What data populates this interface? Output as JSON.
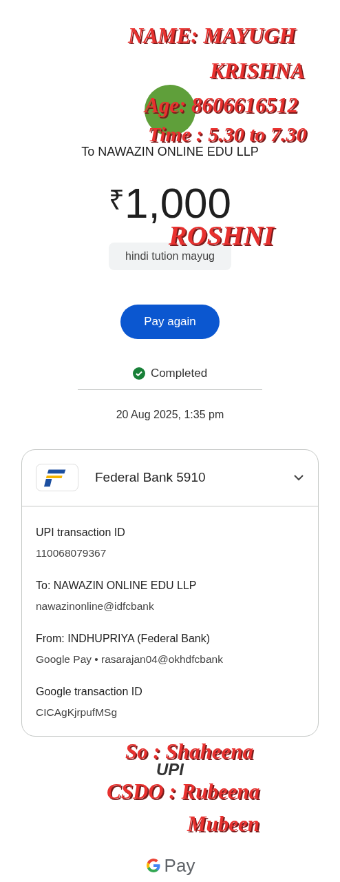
{
  "payee": {
    "line": "To NAWAZIN ONLINE EDU LLP"
  },
  "amount": {
    "currency": "₹",
    "value": "1,000"
  },
  "note": "hindi tution mayug",
  "pay_again_button": "Pay again",
  "status": {
    "label": "Completed"
  },
  "date": "20 Aug 2025, 1:35 pm",
  "account_card": {
    "bank": "Federal Bank 5910",
    "expanded": true,
    "details": [
      {
        "label": "UPI transaction ID",
        "value": "110068079367"
      },
      {
        "label": "To: NAWAZIN ONLINE EDU LLP",
        "value": "nawazinonline@idfcbank"
      },
      {
        "label": "From: INDHUPRIYA (Federal Bank)",
        "value": "Google Pay • rasarajan04@okhdfcbank"
      },
      {
        "label": "Google transaction ID",
        "value": "CICAgKjrpufMSg"
      }
    ]
  },
  "footer": {
    "upi_logo": "UPI",
    "gpay_logo": "Pay"
  },
  "annotations": [
    {
      "text": "NAME:  MAYUGH"
    },
    {
      "text": "KRISHNA"
    },
    {
      "text": "Age: 8606616512"
    },
    {
      "text": "Time : 5.30 to 7.30"
    },
    {
      "text": "ROSHNI"
    },
    {
      "text": "So : Shaheena"
    },
    {
      "text": "CSDO : Rubeena"
    },
    {
      "text": "Mubeen"
    }
  ]
}
